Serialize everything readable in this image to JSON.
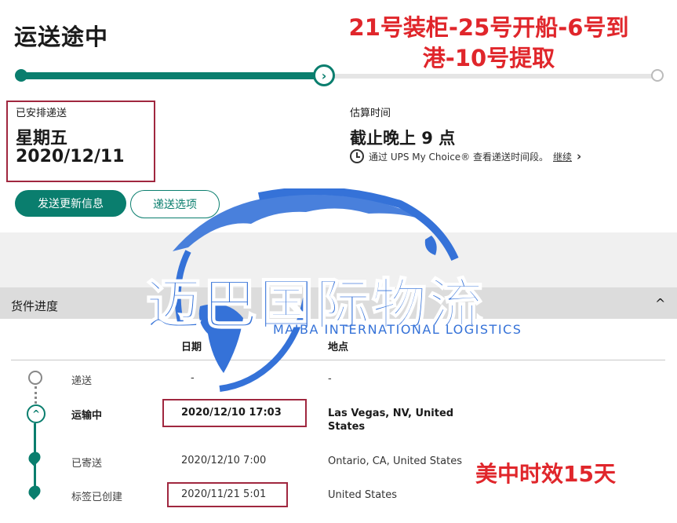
{
  "header": {
    "title": "运送途中",
    "annotation": "21号装柜-25号开船-6号到港-10号提取"
  },
  "progress": {
    "current_step": 2,
    "total_steps": 3
  },
  "delivery": {
    "label": "已安排递送",
    "day": "星期五",
    "date": "2020/12/11"
  },
  "estimate": {
    "label": "估算时间",
    "value": "截止晚上 9 点",
    "info": "通过 UPS My Choice® 查看递送时间段。",
    "more_link": "继续",
    "chevron": "›"
  },
  "buttons": {
    "primary": "发送更新信息",
    "secondary": "递送选项"
  },
  "section": {
    "title": "货件进度",
    "toggle": "^"
  },
  "table": {
    "headers": {
      "date": "日期",
      "location": "地点"
    },
    "rows": [
      {
        "status": "递送",
        "date": "-",
        "location": "-"
      },
      {
        "status": "运输中",
        "date": "2020/12/10  17:03",
        "location": "Las Vegas, NV, United States"
      },
      {
        "status": "已寄送",
        "date": "2020/12/10  7:00",
        "location": "Ontario, CA, United States"
      },
      {
        "status": "标签已创建",
        "date": "2020/11/21  5:01",
        "location": "United States"
      }
    ]
  },
  "watermark": {
    "title": "迈巴国际物流",
    "subtitle": "MAIBA INTERNATIONAL LOGISTICS"
  },
  "annotation_bottom": "美中时效15天",
  "colors": {
    "accent": "#0a7e6e",
    "highlight_box": "#a0273f",
    "annotation": "#e0262b",
    "watermark": "#3572d8"
  }
}
